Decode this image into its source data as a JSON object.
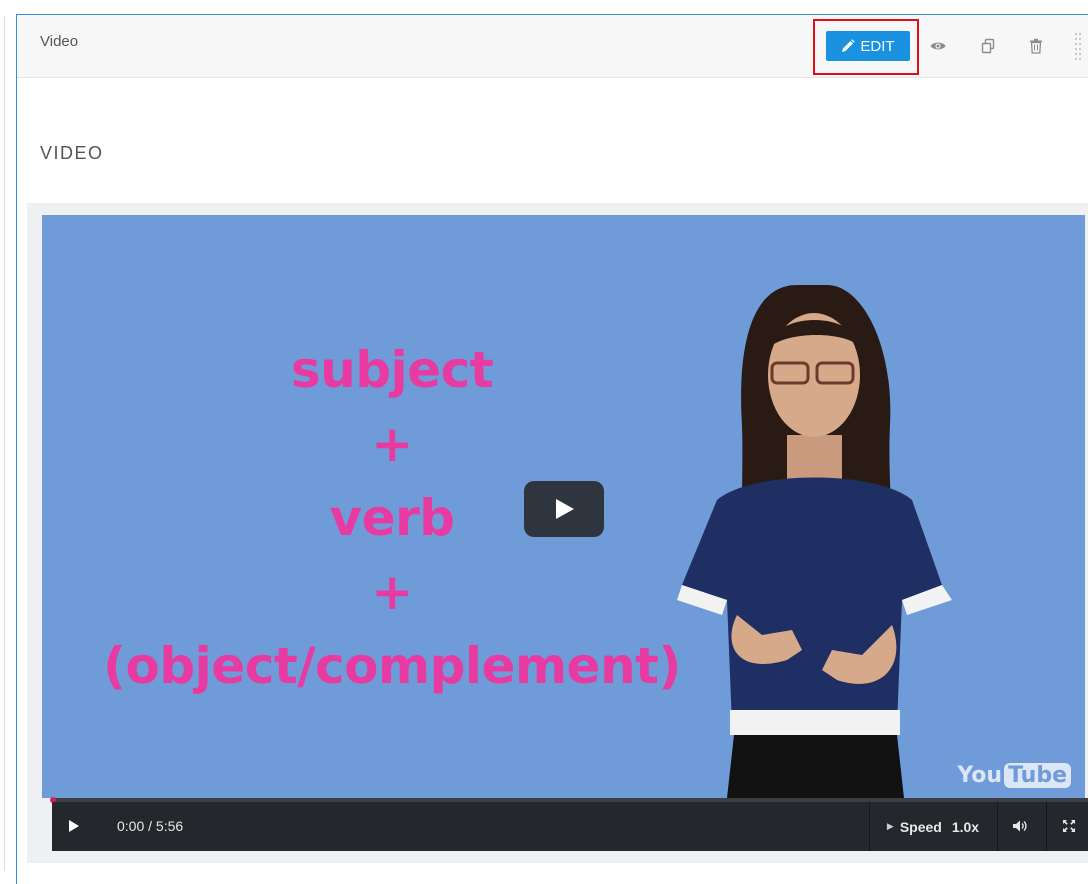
{
  "component": {
    "title": "Video",
    "edit_label": "EDIT",
    "icons": [
      "pencil-icon",
      "eye-icon",
      "duplicate-icon",
      "trash-icon",
      "drag-handle-icon"
    ]
  },
  "section": {
    "label": "VIDEO"
  },
  "video": {
    "formula_lines": [
      "subject",
      "+",
      "verb",
      "+",
      "(object/complement)"
    ],
    "brand_you": "You",
    "brand_tube": "Tube"
  },
  "controls": {
    "time": "0:00 / 5:56",
    "speed_label": "Speed",
    "speed_value": "1.0x",
    "progress": 0
  },
  "colors": {
    "accent": "#1b92e0",
    "highlight": "#e0101b",
    "formula": "#e83ba1",
    "video_bg": "#6f9bd9",
    "progress": "#d41e5f"
  }
}
